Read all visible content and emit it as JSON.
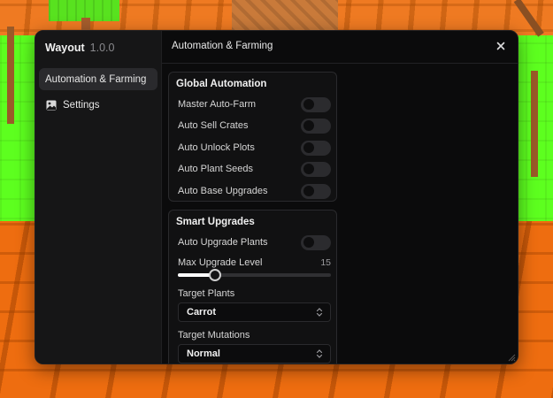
{
  "app": {
    "name": "Wayout",
    "version": "1.0.0"
  },
  "sidebar": {
    "items": [
      {
        "label": "Automation & Farming",
        "icon": "none",
        "active": true
      },
      {
        "label": "Settings",
        "icon": "image-icon",
        "active": false
      }
    ]
  },
  "header": {
    "title": "Automation & Farming",
    "close_icon": "close-icon"
  },
  "global_automation": {
    "title": "Global Automation",
    "toggles": [
      {
        "label": "Master Auto-Farm",
        "on": false
      },
      {
        "label": "Auto Sell Crates",
        "on": false
      },
      {
        "label": "Auto Unlock Plots",
        "on": false
      },
      {
        "label": "Auto Plant Seeds",
        "on": false
      },
      {
        "label": "Auto Base Upgrades",
        "on": false
      }
    ]
  },
  "smart_upgrades": {
    "title": "Smart Upgrades",
    "toggle": {
      "label": "Auto Upgrade Plants",
      "on": false
    },
    "slider": {
      "label": "Max Upgrade Level",
      "value": "15",
      "fraction": 0.24
    },
    "target_plants": {
      "label": "Target Plants",
      "value": "Carrot"
    },
    "target_mutations": {
      "label": "Target Mutations",
      "value": "Normal"
    }
  },
  "colors": {
    "window_bg": "#0b0b0c",
    "sidebar_bg": "#161617",
    "accent": "#ffffff",
    "ground": "#ee6d10",
    "grass": "#5dff1f"
  }
}
